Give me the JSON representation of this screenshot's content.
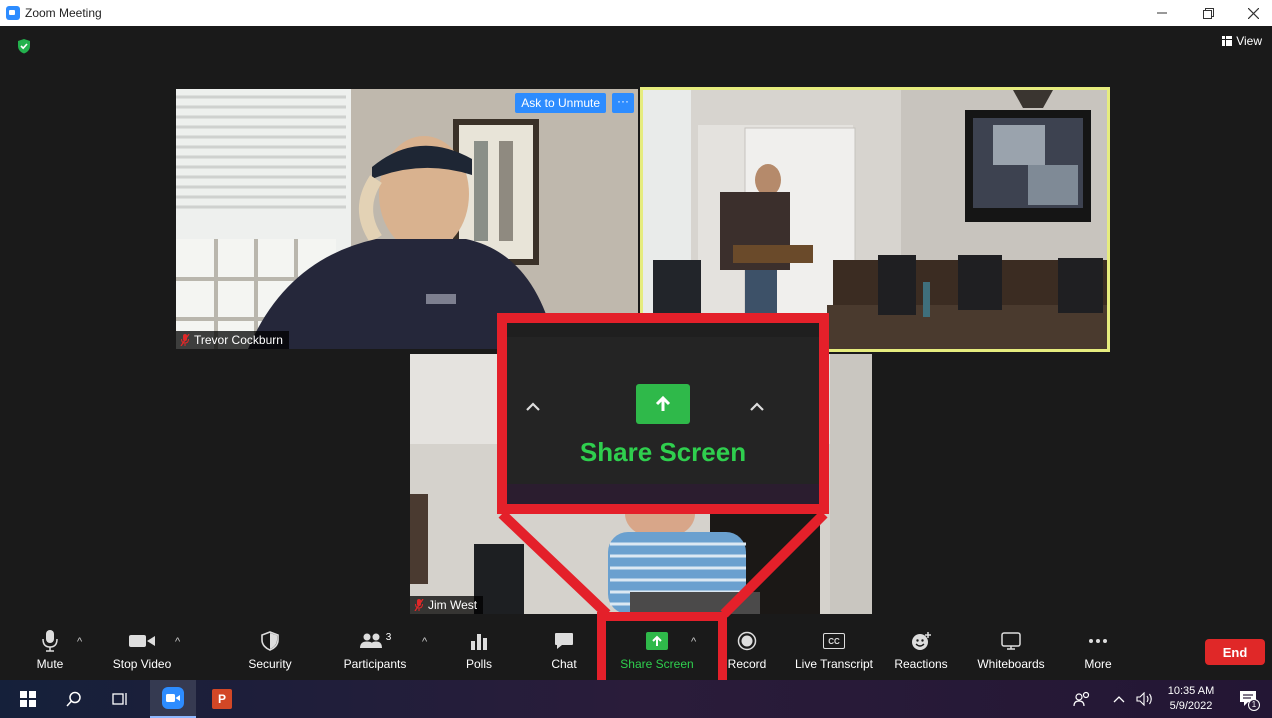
{
  "window": {
    "title": "Zoom Meeting"
  },
  "header": {
    "view_label": "View"
  },
  "tiles": {
    "trevor": {
      "name": "Trevor Cockburn",
      "ask_unmute": "Ask to Unmute",
      "more": "···"
    },
    "jim": {
      "name": "Jim West"
    }
  },
  "callout": {
    "label": "Share Screen"
  },
  "toolbar": {
    "mute": "Mute",
    "stop_video": "Stop Video",
    "security": "Security",
    "participants": "Participants",
    "participants_count": "3",
    "polls": "Polls",
    "chat": "Chat",
    "share_screen": "Share Screen",
    "record": "Record",
    "live_transcript": "Live Transcript",
    "cc": "CC",
    "reactions": "Reactions",
    "whiteboards": "Whiteboards",
    "more": "More",
    "end": "End"
  },
  "taskbar": {
    "time": "10:35 AM",
    "date": "5/9/2022",
    "notif_count": "1"
  },
  "colors": {
    "accent": "#2D8CFF",
    "share_green": "#2FB94A",
    "highlight_red": "#E4202A",
    "end_red": "#E02828",
    "speaker_border": "#E6EC7E"
  }
}
